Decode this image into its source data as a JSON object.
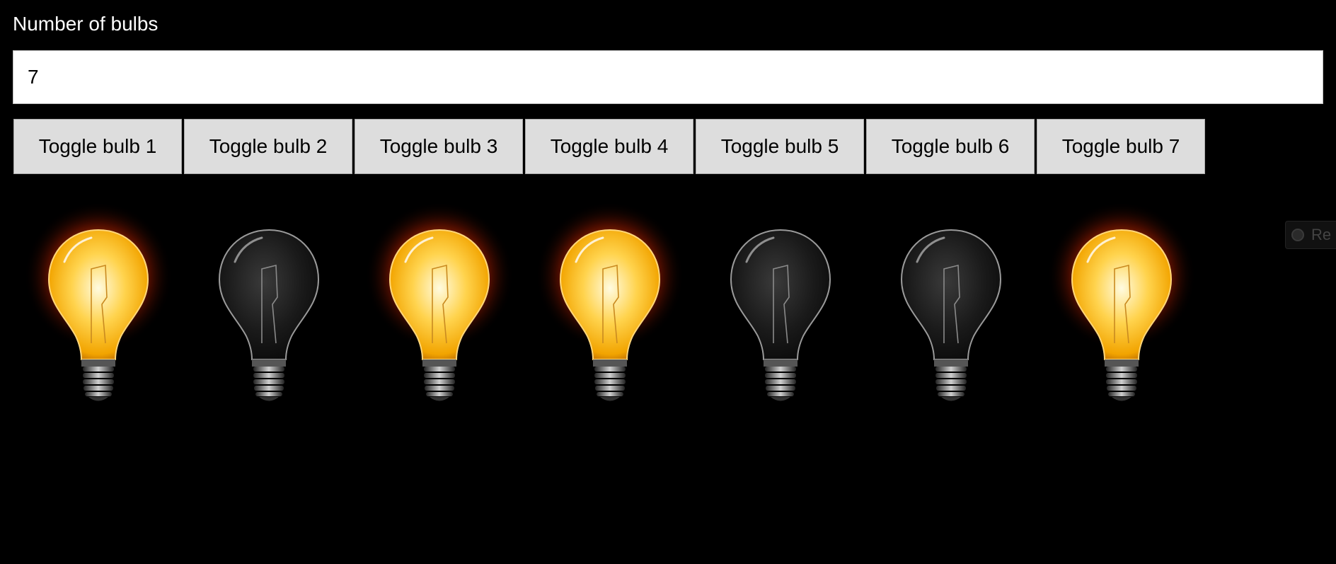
{
  "label": "Number of bulbs",
  "count_input": {
    "value": "7"
  },
  "buttons": [
    {
      "label": "Toggle bulb 1"
    },
    {
      "label": "Toggle bulb 2"
    },
    {
      "label": "Toggle bulb 3"
    },
    {
      "label": "Toggle bulb 4"
    },
    {
      "label": "Toggle bulb 5"
    },
    {
      "label": "Toggle bulb 6"
    },
    {
      "label": "Toggle bulb 7"
    }
  ],
  "bulbs": [
    {
      "state": "on"
    },
    {
      "state": "off"
    },
    {
      "state": "on"
    },
    {
      "state": "on"
    },
    {
      "state": "off"
    },
    {
      "state": "off"
    },
    {
      "state": "on"
    }
  ],
  "side_tab": {
    "icon": "record-icon",
    "label": "Re"
  },
  "colors": {
    "background": "#000000",
    "bulb_on": "#ffd34d",
    "bulb_glow": "#ff5a00",
    "button_bg": "#dddddd"
  }
}
